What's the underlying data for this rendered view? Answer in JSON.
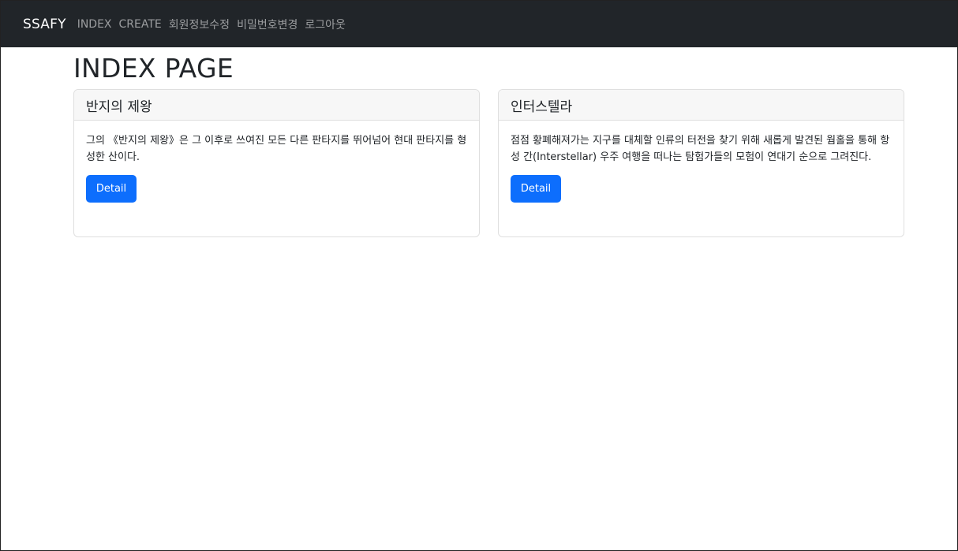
{
  "navbar": {
    "brand": "SSAFY",
    "links": [
      "INDEX",
      "CREATE",
      "회원정보수정",
      "비밀번호변경",
      "로그아웃"
    ]
  },
  "page": {
    "title": "INDEX PAGE"
  },
  "cards": [
    {
      "title": "반지의 제왕",
      "text": "그의 《반지의 제왕》은 그 이후로 쓰여진 모든 다른 판타지를 뛰어넘어 현대 판타지를 형성한 산이다.",
      "button": "Detail"
    },
    {
      "title": "인터스텔라",
      "text": "점점 황폐해져가는 지구를 대체할 인류의 터전을 찾기 위해 새롭게 발견된 웜홀을 통해 항성 간(Interstellar) 우주 여행을 떠나는 탐험가들의 모험이 연대기 순으로 그려진다.",
      "button": "Detail"
    }
  ],
  "colors": {
    "navbar_bg": "#212529",
    "primary": "#0d6efd",
    "card_header_bg": "#f7f7f7"
  }
}
